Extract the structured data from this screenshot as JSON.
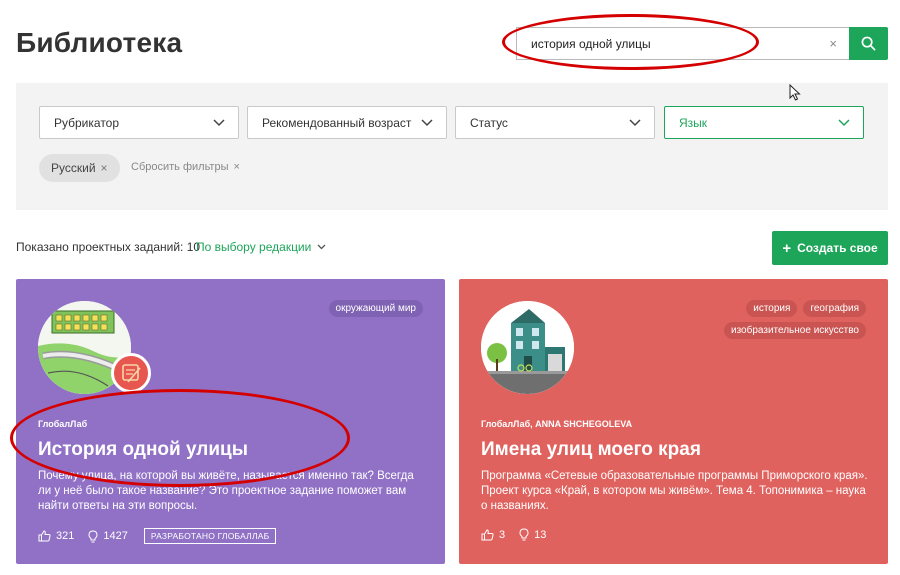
{
  "page": {
    "title": "Библиотека"
  },
  "search": {
    "value": "история одной улицы",
    "clear_icon": "×"
  },
  "filters": {
    "selects": [
      {
        "label": "Рубрикатор"
      },
      {
        "label": "Рекомендованный возраст"
      },
      {
        "label": "Статус"
      },
      {
        "label": "Язык",
        "active": true
      }
    ],
    "chip": {
      "label": "Русский",
      "remove": "×"
    },
    "reset": {
      "label": "Сбросить фильтры",
      "icon": "×"
    }
  },
  "results": {
    "shown_label": "Показано проектных заданий: 10",
    "sort_label": "По выбору редакции",
    "create_label": "Создать свое",
    "create_icon": "+"
  },
  "cards": [
    {
      "tags": [
        "окружающий мир"
      ],
      "author": "ГлобалЛаб",
      "title": "История одной улицы",
      "description": "Почему улица, на которой вы живёте, называется именно так? Всегда ли у неё было такое название? Это проектное задание поможет вам найти ответы на эти вопросы.",
      "likes": "321",
      "ideas": "1427",
      "badge": "РАЗРАБОТАНО ГЛОБАЛЛАБ"
    },
    {
      "tags": [
        "история",
        "география",
        "изобразительное искусство"
      ],
      "author": "ГлобалЛаб, ANNA SHCHEGOLEVA",
      "title": "Имена улиц моего края",
      "description": "Программа «Сетевые образовательные программы Приморского края». Проект курса «Край, в котором мы живём». Тема 4. Топонимика – наука о названиях.",
      "likes": "3",
      "ideas": "13"
    }
  ],
  "colors": {
    "accent": "#1da55a",
    "card_purple": "#9071c6",
    "card_red": "#e0625f",
    "annotation": "#d40000"
  }
}
